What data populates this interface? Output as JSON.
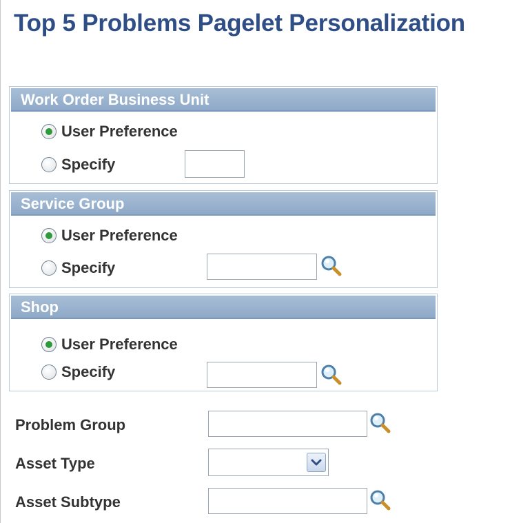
{
  "page": {
    "title": "Top 5 Problems Pagelet Personalization"
  },
  "groups": [
    {
      "header": "Work Order Business Unit",
      "options": [
        "User Preference",
        "Specify"
      ],
      "selected": "User Preference",
      "specify_value": "",
      "has_lookup": false
    },
    {
      "header": "Service Group",
      "options": [
        "User Preference",
        "Specify"
      ],
      "selected": "User Preference",
      "specify_value": "",
      "has_lookup": true
    },
    {
      "header": "Shop",
      "options": [
        "User Preference",
        "Specify"
      ],
      "selected": "User Preference",
      "specify_value": "",
      "has_lookup": true
    }
  ],
  "fields": {
    "problem_group": {
      "label": "Problem Group",
      "value": ""
    },
    "asset_type": {
      "label": "Asset Type",
      "value": ""
    },
    "asset_subtype": {
      "label": "Asset Subtype",
      "value": ""
    }
  },
  "icons": {
    "lookup": "magnifier-icon",
    "dropdown": "chevron-down-icon"
  },
  "colors": {
    "title": "#2f4e86",
    "group_header": "#8ea9c8",
    "radio_selected": "#2f9a3a"
  }
}
